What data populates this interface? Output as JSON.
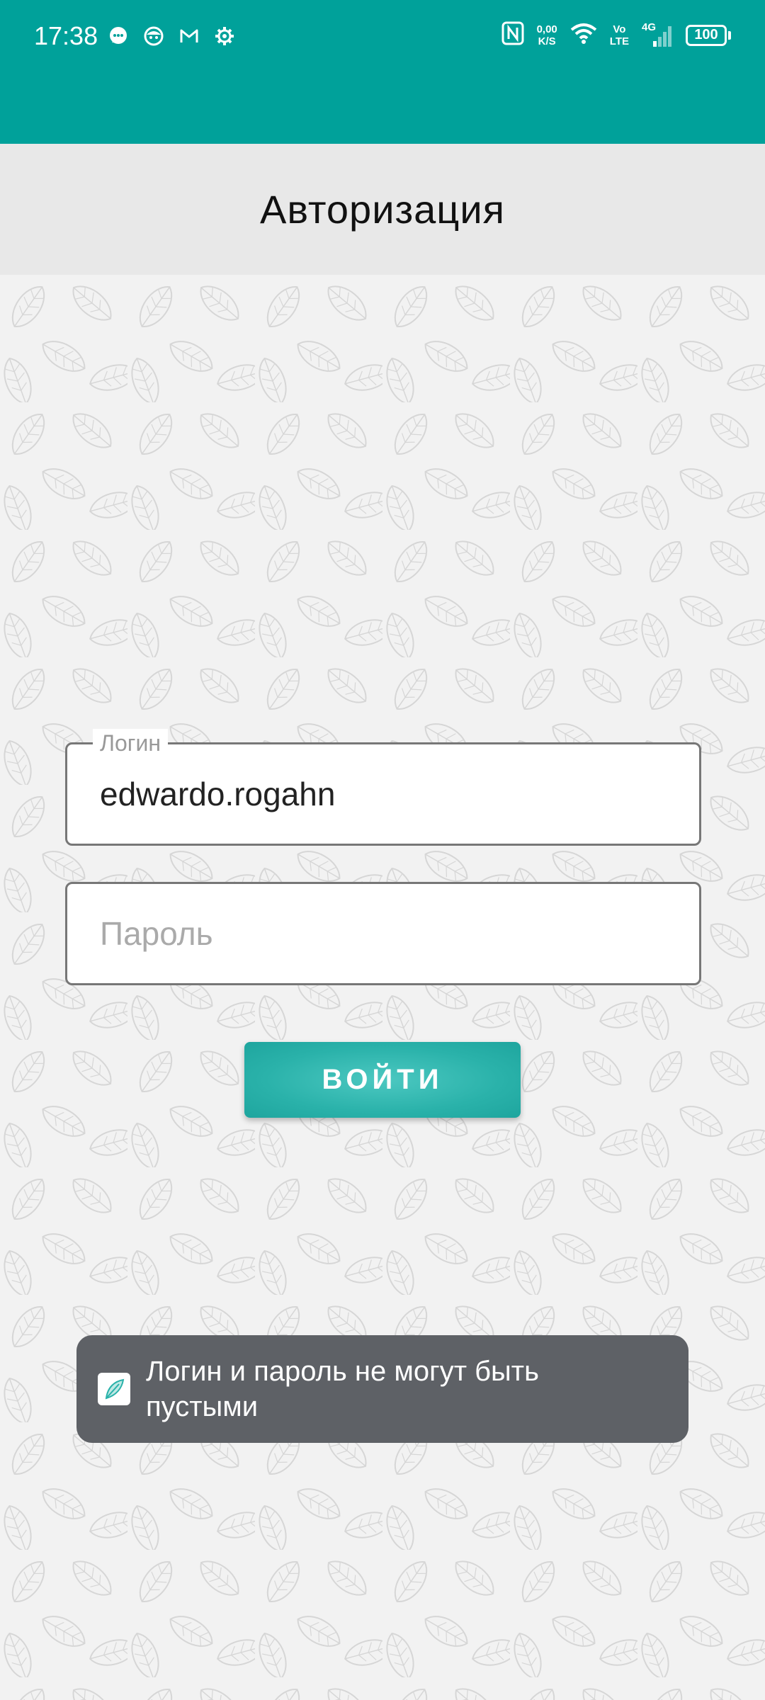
{
  "status_bar": {
    "time": "17:38",
    "left_icons": [
      "chat-icon",
      "face-icon",
      "gmail-icon",
      "settings-icon"
    ],
    "net_speed_value": "0,00",
    "net_speed_unit": "K/S",
    "volte_top": "Vo",
    "volte_bottom": "LTE",
    "network_type": "4G",
    "battery": "100",
    "background_color": "#00a19a"
  },
  "header": {
    "title": "Авторизация"
  },
  "form": {
    "login_label": "Логин",
    "login_value": "edwardo.rogahn",
    "password_placeholder": "Пароль",
    "submit_label": "ВОЙТИ",
    "button_color": "#2ab2aa"
  },
  "toast": {
    "message": "Логин и пароль не могут быть пустыми",
    "background_color": "#5e6166"
  }
}
